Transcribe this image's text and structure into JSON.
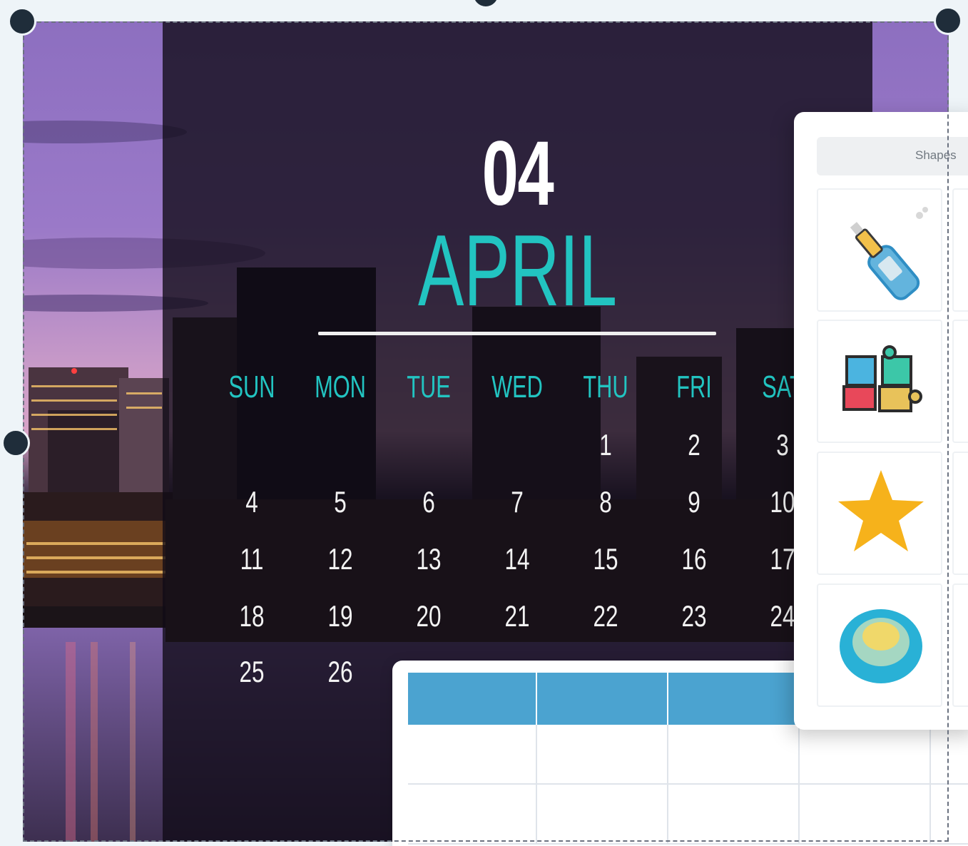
{
  "calendar": {
    "month_number": "04",
    "month_name": "APRIL",
    "weekdays": [
      "SUN",
      "MON",
      "TUE",
      "WED",
      "THU",
      "FRI",
      "SAT"
    ],
    "weeks": [
      [
        "",
        "",
        "",
        "",
        "1",
        "2",
        "3"
      ],
      [
        "4",
        "5",
        "6",
        "7",
        "8",
        "9",
        "10"
      ],
      [
        "11",
        "12",
        "13",
        "14",
        "15",
        "16",
        "17"
      ],
      [
        "18",
        "19",
        "20",
        "21",
        "22",
        "23",
        "24"
      ],
      [
        "25",
        "26",
        "",
        "",
        "",
        "",
        ""
      ]
    ]
  },
  "panel": {
    "tab_label": "Shapes",
    "items": [
      {
        "icon": "champagne-bottle-icon"
      },
      {
        "icon": "puzzle-pieces-icon"
      },
      {
        "icon": "star-icon"
      },
      {
        "icon": "circle-blob-icon"
      }
    ]
  },
  "colors": {
    "accent_teal": "#22c4c1",
    "table_header": "#4ba3d0",
    "star": "#f6b21b"
  }
}
